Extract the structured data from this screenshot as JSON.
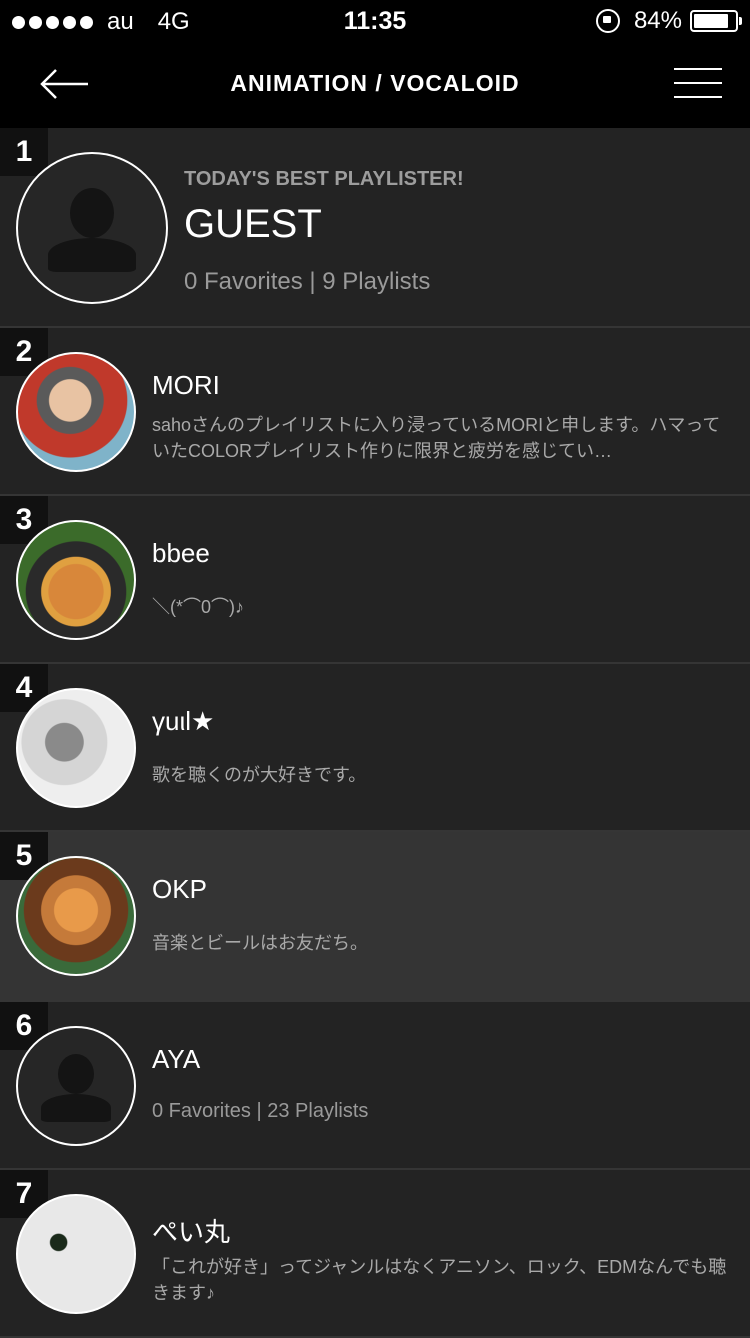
{
  "status_bar": {
    "carrier": "au",
    "network": "4G",
    "time": "11:35",
    "battery": "84%",
    "battery_level": 0.84
  },
  "header": {
    "title": "ANIMATION / VOCALOID"
  },
  "users": [
    {
      "rank": "1",
      "label": "TODAY'S BEST PLAYLISTER!",
      "name": "GUEST",
      "stats": "0 Favorites | 9 Playlists"
    },
    {
      "rank": "2",
      "name": "MORI",
      "desc": "sahoさんのプレイリストに入り浸っているMORIと申します。ハマっていたCOLORプレイリスト作りに限界と疲労を感じてい…"
    },
    {
      "rank": "3",
      "name": "bbee",
      "desc": "＼(*⌒0⌒)♪"
    },
    {
      "rank": "4",
      "name": "γuιl★",
      "desc": "歌を聴くのが大好きです。"
    },
    {
      "rank": "5",
      "name": "OKP",
      "desc": "音楽とビールはお友だち。"
    },
    {
      "rank": "6",
      "name": "AYA",
      "stats": "0 Favorites | 23 Playlists"
    },
    {
      "rank": "7",
      "name": "ぺい丸",
      "desc": "「これが好き」ってジャンルはなくアニソン、ロック、EDMなんでも聴きます♪"
    }
  ]
}
